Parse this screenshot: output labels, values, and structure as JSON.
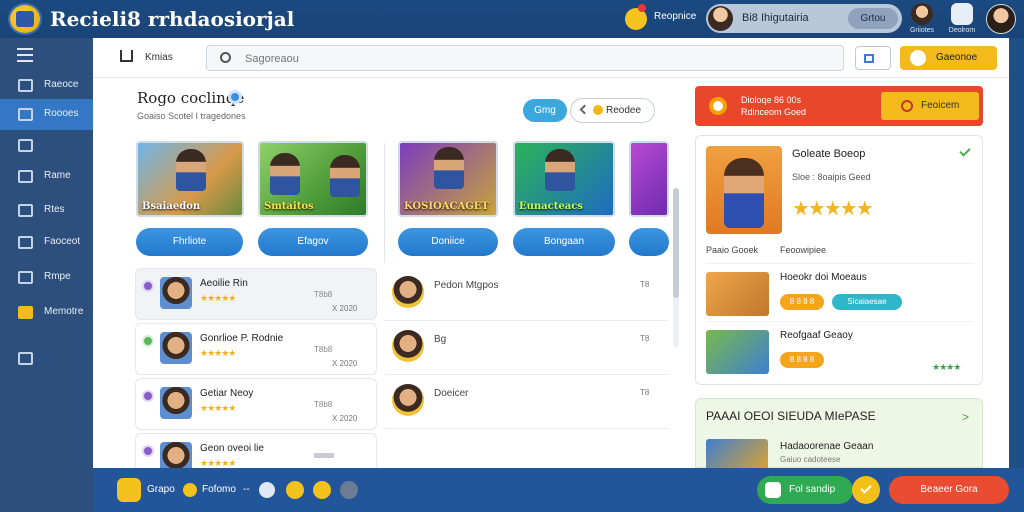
{
  "app": {
    "title": "Recieli8 rrhdaosiorjal"
  },
  "topbar": {
    "notice_label": "Reopnice",
    "user_name": "Bi8 Ihigutairia",
    "user_button": "Grtou",
    "icon1_label": "Griiotes",
    "icon2_label": "Deolrom"
  },
  "sidebar": {
    "items": [
      {
        "label": "Raeoce"
      },
      {
        "label": "Roooes"
      },
      {
        "label": ""
      },
      {
        "label": "Rame"
      },
      {
        "label": "Rtes"
      },
      {
        "label": "Faoceot"
      },
      {
        "label": "Rmpe"
      },
      {
        "label": "Memotre"
      },
      {
        "label": ""
      }
    ]
  },
  "subbar": {
    "crumb": "Kmias",
    "search_placeholder": "Sagoreaou",
    "gold_button": "Gaeonoe"
  },
  "section": {
    "title": "Rogo coclinqe",
    "subtitle": "Goaiso Scotel I tragedones",
    "pill_blue": "Gmg",
    "pill_white": "Reodee"
  },
  "cards": [
    {
      "caption": "Bsaiaedon",
      "button": "Fhrliote"
    },
    {
      "caption": "Smtaitos",
      "button": "Efagov"
    },
    {
      "caption": "KOSIOACAGET",
      "button": "Doniice"
    },
    {
      "caption": "Eunacteacs",
      "button": "Bongaan"
    },
    {
      "caption": "",
      "button": ""
    }
  ],
  "list": [
    {
      "name": "Aeoilie Rin",
      "meta": "T8b8",
      "value": "X 2020"
    },
    {
      "name": "Gonrlioe P. Rodnie",
      "meta": "T8b8",
      "value": "X 2020"
    },
    {
      "name": "Getiar Neoy",
      "meta": "T8b8",
      "value": "X 2020"
    },
    {
      "name": "Geon oveoi lie",
      "meta": "",
      "value": ""
    }
  ],
  "mid": [
    {
      "label": "Pedon Mtgpos",
      "meta": "T8"
    },
    {
      "label": "Bg",
      "meta": "T8"
    },
    {
      "label": "Doeicer",
      "meta": "T8"
    }
  ],
  "promo": {
    "text": "Dioloqe 86 00s Rdinceom Goed",
    "button": "Feoicem"
  },
  "detail": {
    "title": "Goleate Boeop",
    "subtitle": "Sloe : 8oaipis Geed",
    "stars": "★★★★★",
    "cap_left": "Paaio Gooek",
    "cap_right": "Feoowipiee",
    "rows": [
      {
        "title": "Hoeokr doi Moeaus",
        "badge1": "8 8 8 8",
        "badge2": "Sicaiaesae"
      },
      {
        "title": "Reofgaaf Geaoy",
        "badge1": "8 8 8 8",
        "stars": "★★★★"
      }
    ]
  },
  "green_panel": {
    "title": "PAAAI OEOI SIEUDA MIePASE",
    "item_title": "Hadaoorenae Geaan",
    "item_sub": "Gaiuo cadoteese"
  },
  "bottombar": {
    "label1": "Grapo",
    "label2": "Fofomo",
    "sep": "--",
    "green_button": "Fol sandip",
    "red_button": "Beaeer Gora"
  },
  "colors": {
    "topbar": "#1b4a80",
    "sidebar": "#2c4f7d",
    "accent_blue": "#2f86d8",
    "gold": "#f4b91a",
    "promo_red": "#e8472c",
    "green": "#2faa52"
  }
}
